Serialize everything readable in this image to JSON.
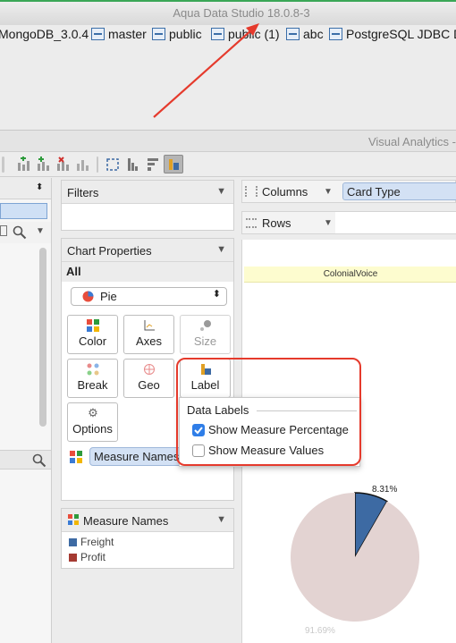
{
  "app": {
    "title": "Aqua Data Studio 18.0.8-3"
  },
  "connections": [
    {
      "label": "MongoDB_3.0.4"
    },
    {
      "label": "master"
    },
    {
      "label": "public"
    },
    {
      "label": "public (1)"
    },
    {
      "label": "abc"
    },
    {
      "label": "PostgreSQL JDBC Dr"
    }
  ],
  "visual_analytics": {
    "title": "Visual Analytics -"
  },
  "filters": {
    "title": "Filters"
  },
  "shelves": {
    "columns_label": "Columns",
    "columns_pill": "Card Type",
    "rows_label": "Rows"
  },
  "chart_properties": {
    "title": "Chart Properties",
    "scope": "All",
    "chart_type": "Pie",
    "buttons": {
      "color": "Color",
      "axes": "Axes",
      "size": "Size",
      "break": "Break",
      "geo": "Geo",
      "label": "Label",
      "options": "Options"
    },
    "measure_pill": "Measure Names"
  },
  "data_labels_popup": {
    "title": "Data Labels",
    "show_percentage": "Show Measure Percentage",
    "show_percentage_checked": true,
    "show_values": "Show Measure Values",
    "show_values_checked": false
  },
  "legend": {
    "title": "Measure Names",
    "items": [
      {
        "label": "Freight",
        "color": "#3d6aa3"
      },
      {
        "label": "Profit",
        "color": "#a53a32"
      }
    ]
  },
  "chart": {
    "header": "ColonialVoice",
    "slices": [
      {
        "label": "8.31%",
        "value": 8.31,
        "color": "#3d6aa3"
      },
      {
        "label": "91.69%",
        "value": 91.69,
        "color": "#e3d3d2"
      }
    ]
  },
  "colors": {
    "accent": "#3d6aa3",
    "annotation": "#e53a2c",
    "pill": "#d3e1f4"
  }
}
